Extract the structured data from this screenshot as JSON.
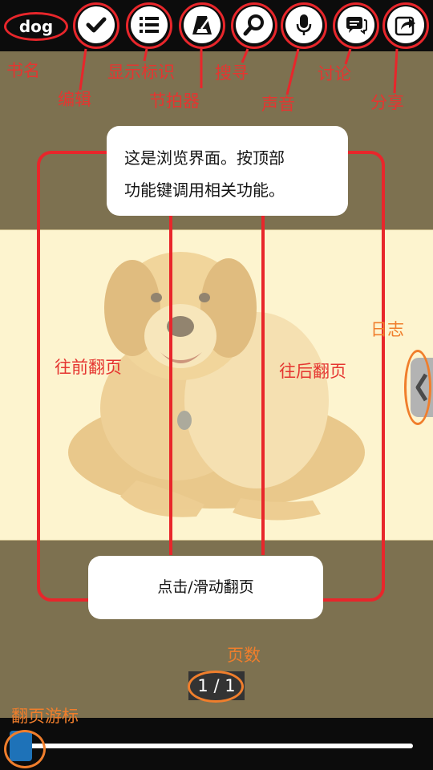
{
  "header": {
    "book_title": "dog"
  },
  "annotations": {
    "book_name": "书名",
    "edit": "编辑",
    "show_marks": "显示标识",
    "metronome": "节拍器",
    "search": "搜寻",
    "sound": "声音",
    "discuss": "讨论",
    "share": "分享",
    "prev_page": "往前翻页",
    "next_page": "往后翻页",
    "log": "日志",
    "page_count": "页数",
    "page_cursor": "翻页游标"
  },
  "tips": {
    "top_line1": "这是浏览界面。按顶部",
    "top_line2": "功能键调用相关功能。",
    "bottom": "点击/滑动翻页"
  },
  "pager": {
    "counter": "1 / 1",
    "slider_position": 0
  },
  "colors": {
    "annotation_red": "#e8262b",
    "annotation_orange": "#f07e2c",
    "background": "#7d7150",
    "page": "#fdf4cf",
    "slider_knob": "#1e72b8"
  },
  "icons": {
    "edit": "checkmark-icon",
    "show_marks": "list-icon",
    "metronome": "metronome-icon",
    "search": "magnifier-icon",
    "sound": "microphone-icon",
    "discuss": "chat-bubbles-icon",
    "share": "share-arrow-icon",
    "log": "chevron-left-icon"
  }
}
